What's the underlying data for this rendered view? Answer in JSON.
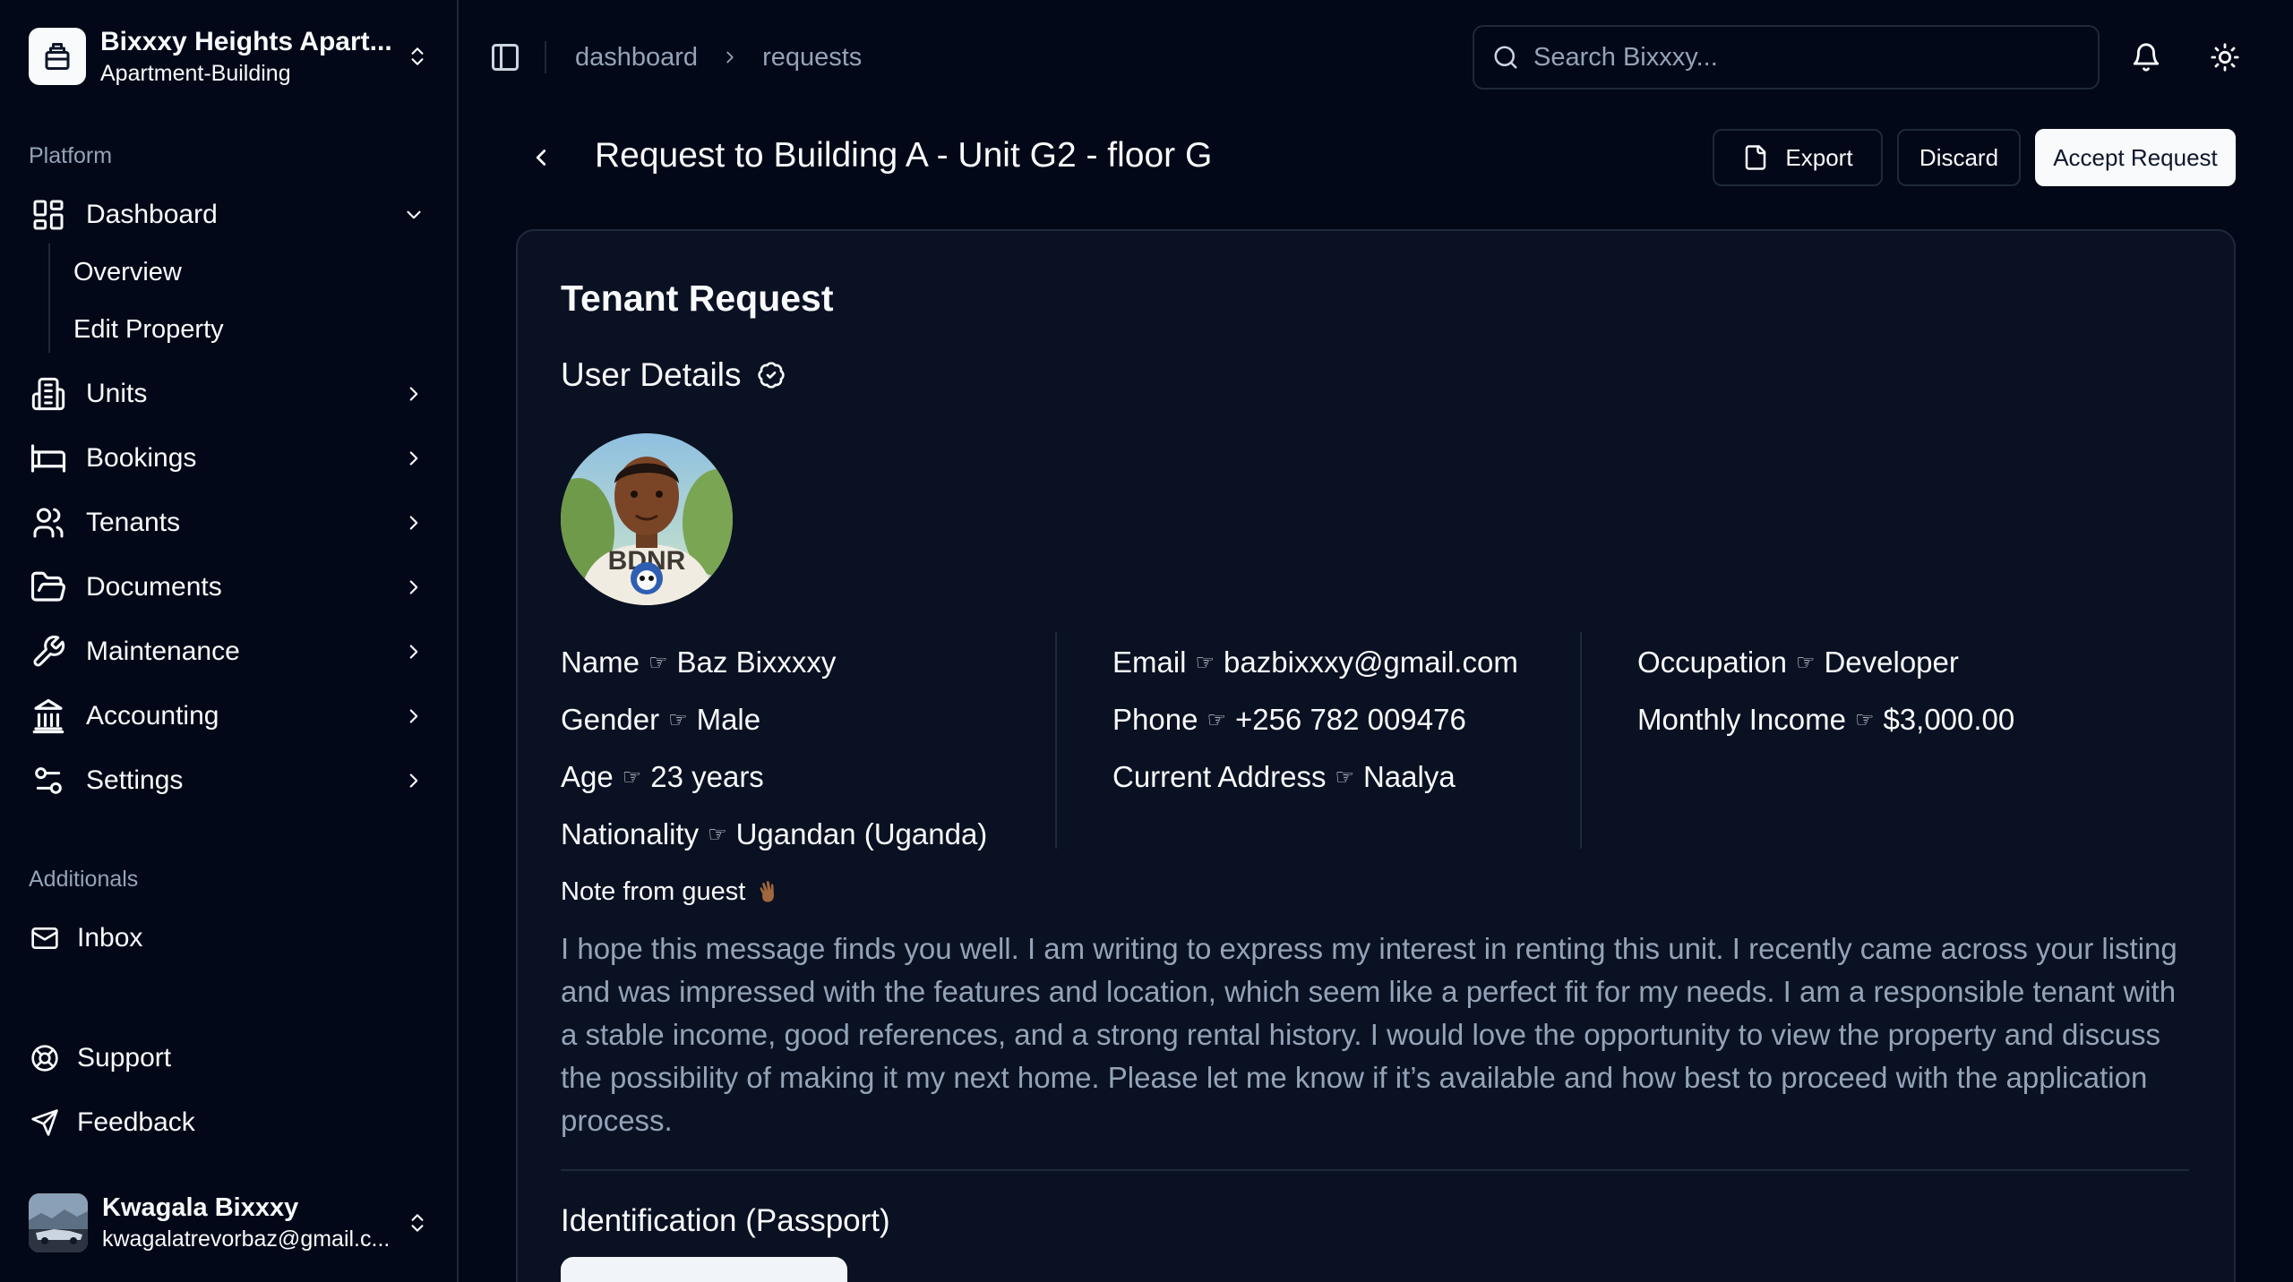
{
  "workspace": {
    "name": "Bixxxy Heights Apart...",
    "type": "Apartment-Building"
  },
  "sidebar": {
    "platform_label": "Platform",
    "nav": [
      {
        "label": "Dashboard",
        "icon": "layout-dashboard-icon",
        "expanded": true
      },
      {
        "label": "Units",
        "icon": "building-icon"
      },
      {
        "label": "Bookings",
        "icon": "bed-icon"
      },
      {
        "label": "Tenants",
        "icon": "users-icon"
      },
      {
        "label": "Documents",
        "icon": "folder-open-icon"
      },
      {
        "label": "Maintenance",
        "icon": "wrench-icon"
      },
      {
        "label": "Accounting",
        "icon": "landmark-icon"
      },
      {
        "label": "Settings",
        "icon": "settings-sliders-icon"
      }
    ],
    "dashboard_sub": [
      "Overview",
      "Edit Property"
    ],
    "additionals_label": "Additionals",
    "inbox_label": "Inbox",
    "support_label": "Support",
    "feedback_label": "Feedback"
  },
  "user": {
    "name": "Kwagala Bixxxy",
    "email": "kwagalatrevorbaz@gmail.c..."
  },
  "topbar": {
    "breadcrumb": [
      "dashboard",
      "requests"
    ],
    "search_placeholder": "Search Bixxxy..."
  },
  "header": {
    "title": "Request to Building A - Unit G2 - floor G",
    "export_label": "Export",
    "discard_label": "Discard",
    "accept_label": "Accept Request"
  },
  "card": {
    "title": "Tenant Request",
    "user_details_label": "User Details",
    "avatar_shirt_text": "BDNR",
    "separator_glyph": "☞",
    "columns": [
      [
        {
          "label": "Name",
          "value": "Baz Bixxxxy"
        },
        {
          "label": "Gender",
          "value": "Male"
        },
        {
          "label": "Age",
          "value": "23 years"
        },
        {
          "label": "Nationality",
          "value": "Ugandan (Uganda)"
        }
      ],
      [
        {
          "label": "Email",
          "value": "bazbixxxy@gmail.com"
        },
        {
          "label": "Phone",
          "value": "+256 782 009476"
        },
        {
          "label": "Current Address",
          "value": "Naalya"
        }
      ],
      [
        {
          "label": "Occupation",
          "value": "Developer"
        },
        {
          "label": "Monthly Income",
          "value": "$3,000.00"
        }
      ]
    ],
    "note_label": "Note from guest",
    "note_text": "I hope this message finds you well. I am writing to express my interest in renting this unit. I recently came across your listing and was impressed with the features and location, which seem like a perfect fit for my needs. I am a responsible tenant with a stable income, good references, and a strong rental history. I would love the opportunity to view the property and discuss the possibility of making it my next home. Please let me know if it’s available and how best to proceed with the application process.",
    "identification_label": "Identification (Passport)"
  },
  "colors": {
    "background": "#020817",
    "card": "#0a1122",
    "border": "#1e293b",
    "muted_text": "#94a3b8",
    "foreground": "#f8fafc"
  }
}
